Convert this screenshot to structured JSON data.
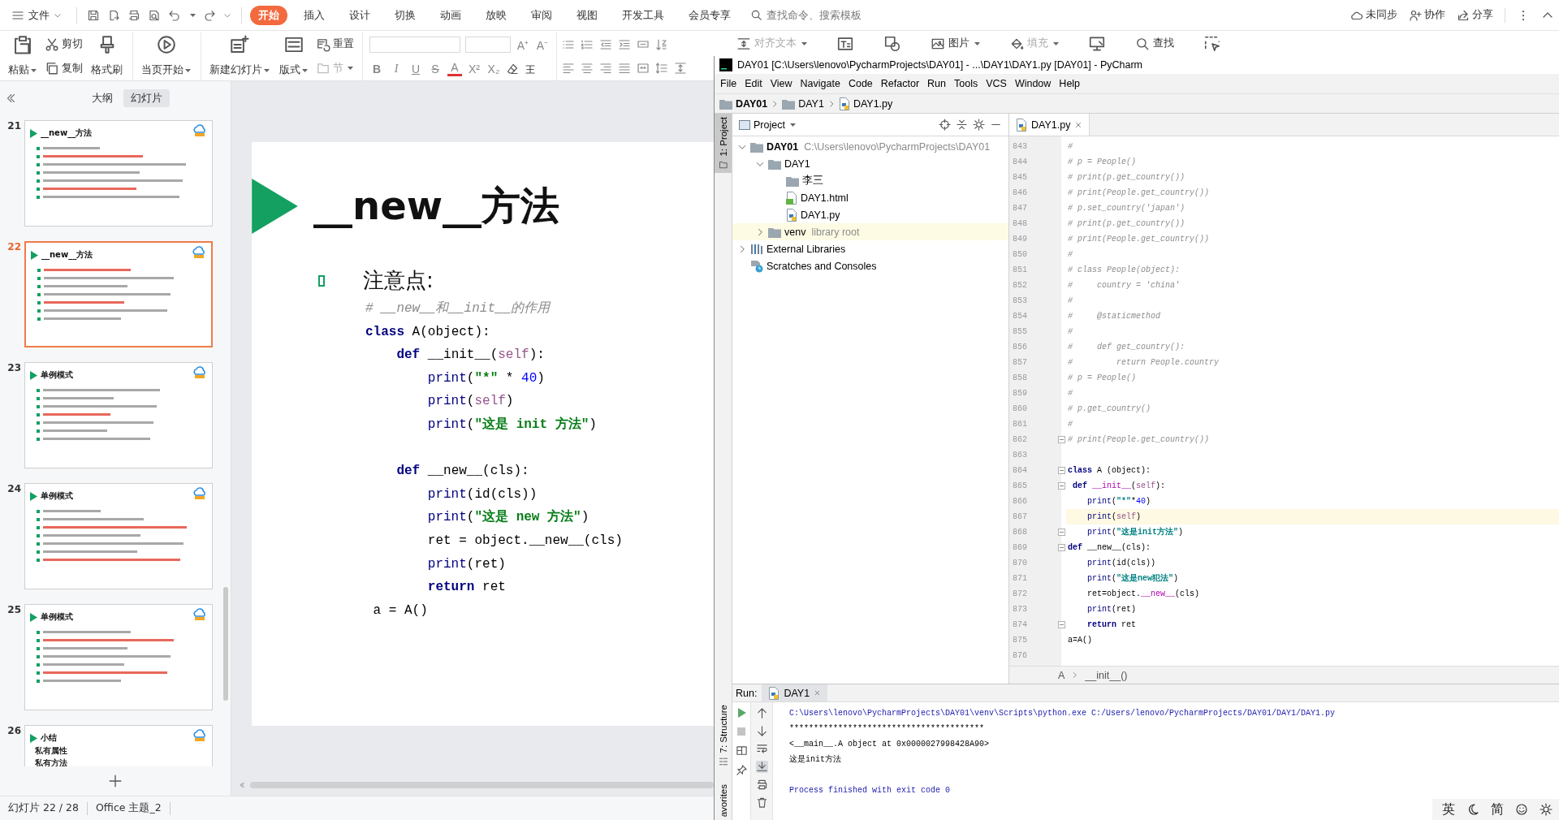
{
  "wps": {
    "file_menu": "文件",
    "tabs": [
      {
        "label": "开始",
        "selected": true
      },
      {
        "label": "插入",
        "selected": false
      },
      {
        "label": "设计",
        "selected": false
      },
      {
        "label": "切换",
        "selected": false
      },
      {
        "label": "动画",
        "selected": false
      },
      {
        "label": "放映",
        "selected": false
      },
      {
        "label": "审阅",
        "selected": false
      },
      {
        "label": "视图",
        "selected": false
      },
      {
        "label": "开发工具",
        "selected": false
      },
      {
        "label": "会员专享",
        "selected": false
      }
    ],
    "search": {
      "placeholder": "查找命令、搜索模板"
    },
    "account": [
      {
        "kind": "cloud",
        "label": "未同步"
      },
      {
        "kind": "collaborate",
        "label": "协作"
      },
      {
        "kind": "share",
        "label": "分享"
      }
    ],
    "ribbon_groups": [
      [
        {
          "kind": "paste",
          "label": "粘贴",
          "dropdown": true,
          "disabled": false
        },
        {
          "stack": [
            {
              "kind": "cut",
              "label": "剪切",
              "dropdown": false,
              "disabled": false
            },
            {
              "kind": "copy",
              "label": "复制",
              "dropdown": false,
              "disabled": false
            }
          ]
        },
        {
          "kind": "format_painter",
          "label": "格式刷",
          "dropdown": false,
          "disabled": false
        }
      ],
      [
        {
          "kind": "slideshow",
          "label": "当页开始",
          "dropdown": true,
          "disabled": false
        }
      ],
      [
        {
          "kind": "new_slide",
          "label": "新建幻灯片",
          "dropdown": true,
          "disabled": false
        },
        {
          "kind": "layout",
          "label": "版式",
          "dropdown": true,
          "disabled": false
        },
        {
          "stack": [
            {
              "kind": "reset",
              "label": "重置",
              "dropdown": false,
              "disabled": false
            },
            {
              "kind": "section",
              "label": "节",
              "dropdown": true,
              "disabled": true
            }
          ]
        }
      ]
    ],
    "font_tools": {
      "size_buttons": [
        "A⁺",
        "A⁻"
      ],
      "style_buttons": [
        "B",
        "I",
        "U",
        "S",
        "A",
        "X²",
        "X₂"
      ]
    },
    "insert_tools": [
      {
        "kind": "align_text",
        "label": "对齐文本",
        "dropdown": true,
        "disabled": true
      },
      {
        "kind": "textbox"
      },
      {
        "kind": "shapes"
      },
      {
        "kind": "picture",
        "label": "图片",
        "dropdown": true,
        "disabled": false
      },
      {
        "kind": "fill",
        "label": "填充",
        "dropdown": true,
        "disabled": true
      },
      {
        "kind": "screen"
      },
      {
        "kind": "find",
        "label": "查找",
        "dropdown": false,
        "disabled": false
      },
      {
        "kind": "select"
      }
    ],
    "panel_tabs": [
      {
        "label": "大纲",
        "selected": false
      },
      {
        "label": "幻灯片",
        "selected": true
      }
    ],
    "thumbnails": [
      {
        "number": "21",
        "title": "__new__方法",
        "selected": false
      },
      {
        "number": "22",
        "title": "__new__方法",
        "selected": true
      },
      {
        "number": "23",
        "title": "单例模式",
        "selected": false
      },
      {
        "number": "24",
        "title": "单例模式",
        "selected": false
      },
      {
        "number": "25",
        "title": "单例模式",
        "selected": false
      },
      {
        "number": "26",
        "title": "小结",
        "selected": false,
        "body": [
          "私有属性",
          "私有方法"
        ]
      }
    ],
    "slide": {
      "title": "__new__方法",
      "heading": "注意点:",
      "code": [
        {
          "tokens": [
            {
              "kind": "comment",
              "text": "# __new__和__init__的作用"
            }
          ]
        },
        {
          "tokens": [
            {
              "kind": "keyword",
              "text": "class"
            },
            {
              "kind": "plain",
              "text": " A(object):"
            }
          ]
        },
        {
          "tokens": [
            {
              "kind": "keyword",
              "text": "    def"
            },
            {
              "kind": "plain",
              "text": " __init__("
            },
            {
              "kind": "self",
              "text": "self"
            },
            {
              "kind": "plain",
              "text": "):"
            }
          ]
        },
        {
          "tokens": [
            {
              "kind": "builtin",
              "text": "        print"
            },
            {
              "kind": "plain",
              "text": "("
            },
            {
              "kind": "string",
              "text": "\"*\""
            },
            {
              "kind": "plain",
              "text": " * "
            },
            {
              "kind": "number",
              "text": "40"
            },
            {
              "kind": "plain",
              "text": ")"
            }
          ]
        },
        {
          "tokens": [
            {
              "kind": "builtin",
              "text": "        print"
            },
            {
              "kind": "plain",
              "text": "("
            },
            {
              "kind": "self",
              "text": "self"
            },
            {
              "kind": "plain",
              "text": ")"
            }
          ]
        },
        {
          "tokens": [
            {
              "kind": "builtin",
              "text": "        print"
            },
            {
              "kind": "plain",
              "text": "("
            },
            {
              "kind": "string",
              "text": "\"这是 init 方法\""
            },
            {
              "kind": "plain",
              "text": ")"
            }
          ]
        },
        {
          "gap_before": true,
          "tokens": [
            {
              "kind": "keyword",
              "text": "    def"
            },
            {
              "kind": "plain",
              "text": " __new__(cls):"
            }
          ]
        },
        {
          "tokens": [
            {
              "kind": "builtin",
              "text": "        print"
            },
            {
              "kind": "plain",
              "text": "(id(cls))"
            }
          ]
        },
        {
          "tokens": [
            {
              "kind": "builtin",
              "text": "        print"
            },
            {
              "kind": "plain",
              "text": "("
            },
            {
              "kind": "string",
              "text": "\"这是 new 方法\""
            },
            {
              "kind": "plain",
              "text": ")"
            }
          ]
        },
        {
          "tokens": [
            {
              "kind": "plain",
              "text": "        ret = object.__new__(cls)"
            }
          ]
        },
        {
          "tokens": [
            {
              "kind": "builtin",
              "text": "        print"
            },
            {
              "kind": "plain",
              "text": "(ret)"
            }
          ]
        },
        {
          "tokens": [
            {
              "kind": "keyword",
              "text": "        return"
            },
            {
              "kind": "plain",
              "text": " ret"
            }
          ]
        },
        {
          "tokens": [
            {
              "kind": "plain",
              "text": " a = A()"
            }
          ]
        }
      ]
    },
    "status": {
      "slide": "幻灯片 22 / 28",
      "theme": "Office 主题_2"
    }
  },
  "pycharm": {
    "title": "DAY01 [C:\\Users\\lenovo\\PycharmProjects\\DAY01] - ...\\DAY1\\DAY1.py [DAY01] - PyCharm",
    "menu": [
      "File",
      "Edit",
      "View",
      "Navigate",
      "Code",
      "Refactor",
      "Run",
      "Tools",
      "VCS",
      "Window",
      "Help"
    ],
    "breadcrumbs": [
      {
        "kind": "project",
        "label": "DAY01"
      },
      {
        "kind": "folder",
        "label": "DAY1"
      },
      {
        "kind": "python",
        "label": "DAY1.py"
      }
    ],
    "side_tools": [
      {
        "label": "1: Project",
        "selected": true
      },
      {
        "label": "7: Structure",
        "selected": false
      },
      {
        "label": "avorites",
        "selected": false
      }
    ],
    "project": {
      "title": "Project",
      "tree": [
        {
          "label": "DAY01",
          "kind": "project",
          "note": "C:\\Users\\lenovo\\PycharmProjects\\DAY01",
          "expanded": true,
          "highlighted": false,
          "children": [
            {
              "label": "DAY1",
              "kind": "folder",
              "expanded": true,
              "highlighted": false,
              "children": [
                {
                  "label": "李三",
                  "kind": "folder",
                  "highlighted": false
                },
                {
                  "label": "DAY1.html",
                  "kind": "html",
                  "highlighted": false
                },
                {
                  "label": "DAY1.py",
                  "kind": "python",
                  "highlighted": false
                }
              ]
            },
            {
              "label": "venv",
              "kind": "folder",
              "note": "library root",
              "expanded": false,
              "highlighted": true
            }
          ]
        },
        {
          "label": "External Libraries",
          "kind": "libraries",
          "expanded": false,
          "highlighted": false
        },
        {
          "label": "Scratches and Consoles",
          "kind": "scratches",
          "highlighted": false
        }
      ]
    },
    "editor": {
      "tabs": [
        {
          "label": "DAY1.py",
          "selected": true
        }
      ],
      "lines": [
        {
          "number": "843",
          "current": false,
          "fold": false,
          "tokens": [
            {
              "kind": "comment",
              "text": "#"
            }
          ]
        },
        {
          "number": "844",
          "current": false,
          "fold": false,
          "tokens": [
            {
              "kind": "comment",
              "text": "# p = People()"
            }
          ]
        },
        {
          "number": "845",
          "current": false,
          "fold": false,
          "tokens": [
            {
              "kind": "comment",
              "text": "# print(p.get_country())"
            }
          ]
        },
        {
          "number": "846",
          "current": false,
          "fold": false,
          "tokens": [
            {
              "kind": "comment",
              "text": "# print(People.get_country())"
            }
          ]
        },
        {
          "number": "847",
          "current": false,
          "fold": false,
          "tokens": [
            {
              "kind": "comment",
              "text": "# p.set_country('japan')"
            }
          ]
        },
        {
          "number": "848",
          "current": false,
          "fold": false,
          "tokens": [
            {
              "kind": "comment",
              "text": "# print(p.get_country())"
            }
          ]
        },
        {
          "number": "849",
          "current": false,
          "fold": false,
          "tokens": [
            {
              "kind": "comment",
              "text": "# print(People.get_country())"
            }
          ]
        },
        {
          "number": "850",
          "current": false,
          "fold": false,
          "tokens": [
            {
              "kind": "comment",
              "text": "#"
            }
          ]
        },
        {
          "number": "851",
          "current": false,
          "fold": false,
          "tokens": [
            {
              "kind": "comment",
              "text": "# class People(object):"
            }
          ]
        },
        {
          "number": "852",
          "current": false,
          "fold": false,
          "tokens": [
            {
              "kind": "comment",
              "text": "#     country = 'china'"
            }
          ]
        },
        {
          "number": "853",
          "current": false,
          "fold": false,
          "tokens": [
            {
              "kind": "comment",
              "text": "#"
            }
          ]
        },
        {
          "number": "854",
          "current": false,
          "fold": false,
          "tokens": [
            {
              "kind": "comment",
              "text": "#     @staticmethod"
            }
          ]
        },
        {
          "number": "855",
          "current": false,
          "fold": false,
          "tokens": [
            {
              "kind": "comment",
              "text": "#"
            }
          ]
        },
        {
          "number": "856",
          "current": false,
          "fold": false,
          "tokens": [
            {
              "kind": "comment",
              "text": "#     def get_country():"
            }
          ]
        },
        {
          "number": "857",
          "current": false,
          "fold": false,
          "tokens": [
            {
              "kind": "comment",
              "text": "#         return People.country"
            }
          ]
        },
        {
          "number": "858",
          "current": false,
          "fold": false,
          "tokens": [
            {
              "kind": "comment",
              "text": "# p = People()"
            }
          ]
        },
        {
          "number": "859",
          "current": false,
          "fold": false,
          "tokens": [
            {
              "kind": "comment",
              "text": "#"
            }
          ]
        },
        {
          "number": "860",
          "current": false,
          "fold": false,
          "tokens": [
            {
              "kind": "comment",
              "text": "# p.get_country()"
            }
          ]
        },
        {
          "number": "861",
          "current": false,
          "fold": false,
          "tokens": [
            {
              "kind": "comment",
              "text": "#"
            }
          ]
        },
        {
          "number": "862",
          "current": false,
          "fold": true,
          "tokens": [
            {
              "kind": "comment",
              "text": "# print(People.get_country())"
            }
          ]
        },
        {
          "number": "863",
          "current": false,
          "fold": false
        },
        {
          "number": "864",
          "current": false,
          "fold": true,
          "tokens": [
            {
              "kind": "keyword",
              "text": "class"
            },
            {
              "kind": "plain",
              "text": " A (object):"
            }
          ]
        },
        {
          "number": "865",
          "current": false,
          "fold": true,
          "tokens": [
            {
              "kind": "keyword",
              "text": " def"
            },
            {
              "kind": "magic",
              "text": " __init__"
            },
            {
              "kind": "plain",
              "text": "("
            },
            {
              "kind": "self",
              "text": "self"
            },
            {
              "kind": "plain",
              "text": "):"
            }
          ]
        },
        {
          "number": "866",
          "current": false,
          "fold": false,
          "tokens": [
            {
              "kind": "builtin",
              "text": "    print"
            },
            {
              "kind": "plain",
              "text": "("
            },
            {
              "kind": "string",
              "text": "\"*\""
            },
            {
              "kind": "plain",
              "text": "*"
            },
            {
              "kind": "number",
              "text": "40"
            },
            {
              "kind": "plain",
              "text": ")"
            }
          ]
        },
        {
          "number": "867",
          "current": true,
          "fold": false,
          "tokens": [
            {
              "kind": "builtin",
              "text": "    print"
            },
            {
              "kind": "plain",
              "text": "("
            },
            {
              "kind": "self",
              "text": "self"
            },
            {
              "kind": "plain",
              "text": ")"
            }
          ]
        },
        {
          "number": "868",
          "current": false,
          "fold": true,
          "tokens": [
            {
              "kind": "builtin",
              "text": "    print"
            },
            {
              "kind": "plain",
              "text": "("
            },
            {
              "kind": "string",
              "text": "\"这是init方法\""
            },
            {
              "kind": "plain",
              "text": ")"
            }
          ]
        },
        {
          "number": "869",
          "current": false,
          "fold": true,
          "tokens": [
            {
              "kind": "keyword",
              "text": "def"
            },
            {
              "kind": "plain",
              "text": " __new__(cls):"
            }
          ]
        },
        {
          "number": "870",
          "current": false,
          "fold": false,
          "tokens": [
            {
              "kind": "builtin",
              "text": "    print"
            },
            {
              "kind": "plain",
              "text": "(id(cls))"
            }
          ]
        },
        {
          "number": "871",
          "current": false,
          "fold": false,
          "tokens": [
            {
              "kind": "builtin",
              "text": "    print"
            },
            {
              "kind": "plain",
              "text": "("
            },
            {
              "kind": "string",
              "text": "\"这是new犯法\""
            },
            {
              "kind": "plain",
              "text": ")"
            }
          ]
        },
        {
          "number": "872",
          "current": false,
          "fold": false,
          "tokens": [
            {
              "kind": "plain",
              "text": "    ret=object."
            },
            {
              "kind": "magic",
              "text": "__new__"
            },
            {
              "kind": "plain",
              "text": "(cls)"
            }
          ]
        },
        {
          "number": "873",
          "current": false,
          "fold": false,
          "tokens": [
            {
              "kind": "builtin",
              "text": "    print"
            },
            {
              "kind": "plain",
              "text": "(ret)"
            }
          ]
        },
        {
          "number": "874",
          "current": false,
          "fold": true,
          "tokens": [
            {
              "kind": "keyword",
              "text": "    return"
            },
            {
              "kind": "plain",
              "text": " ret"
            }
          ]
        },
        {
          "number": "875",
          "current": false,
          "fold": false,
          "tokens": [
            {
              "kind": "plain",
              "text": "a=A()"
            }
          ]
        },
        {
          "number": "876",
          "current": false,
          "fold": false
        }
      ],
      "breadcrumbs": [
        "A",
        "__init__()"
      ]
    },
    "run": {
      "label": "Run:",
      "tabs": [
        {
          "label": "DAY1",
          "selected": true
        }
      ],
      "output": [
        {
          "kind": "command",
          "text": "C:\\Users\\lenovo\\PycharmProjects\\DAY01\\venv\\Scripts\\python.exe C:/Users/lenovo/PycharmProjects/DAY01/DAY1/DAY1.py"
        },
        {
          "kind": "stdout",
          "text": "****************************************"
        },
        {
          "kind": "stdout",
          "text": "<__main__.A object at 0x0000027998428A90>"
        },
        {
          "kind": "stdout",
          "text": "这是init方法"
        },
        {
          "kind": "system",
          "text": "Process finished with exit code 0"
        }
      ]
    }
  },
  "ime": {
    "labels": [
      "英",
      "简"
    ]
  }
}
